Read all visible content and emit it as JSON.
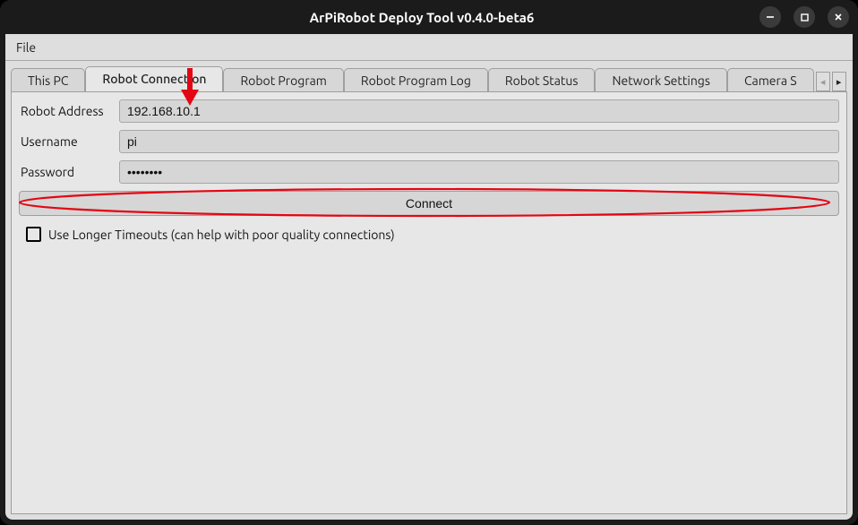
{
  "window": {
    "title": "ArPiRobot Deploy Tool v0.4.0-beta6"
  },
  "menubar": {
    "items": [
      "File"
    ]
  },
  "tabs": {
    "items": [
      {
        "label": "This PC"
      },
      {
        "label": "Robot Connection"
      },
      {
        "label": "Robot Program"
      },
      {
        "label": "Robot Program Log"
      },
      {
        "label": "Robot Status"
      },
      {
        "label": "Network Settings"
      },
      {
        "label": "Camera S"
      }
    ],
    "active_index": 1
  },
  "form": {
    "robot_address": {
      "label": "Robot Address",
      "value": "192.168.10.1"
    },
    "username": {
      "label": "Username",
      "value": "pi"
    },
    "password": {
      "label": "Password",
      "value": "••••••••"
    },
    "connect_button": "Connect",
    "longer_timeouts": {
      "label": "Use Longer Timeouts (can help with poor quality connections)",
      "checked": false
    }
  },
  "annotations": {
    "arrow_color": "#e30613",
    "ellipse_color": "#e30613"
  }
}
